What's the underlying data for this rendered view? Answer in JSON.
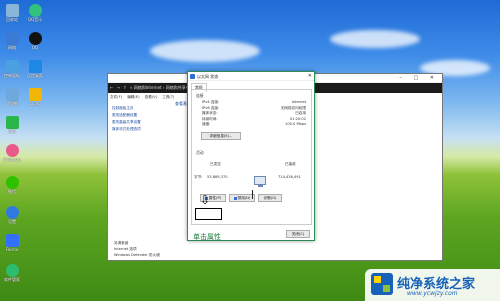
{
  "desktop": {
    "icons_col1": [
      {
        "label": "回收站",
        "color": "#8ab4d8"
      },
      {
        "label": "网络",
        "color": "#3a7bd5"
      },
      {
        "label": "控制面板",
        "color": "#4aa0e0"
      },
      {
        "label": "此电脑",
        "color": "#6fa8dc"
      },
      {
        "label": "360",
        "color": "#2bb54a"
      },
      {
        "label": "Snipaste",
        "color": "#e85a8a"
      },
      {
        "label": "微信",
        "color": "#2dc100"
      },
      {
        "label": "设置",
        "color": "#2f7ae0"
      },
      {
        "label": "Feishu",
        "color": "#3370ff"
      },
      {
        "label": "软件管家",
        "color": "#2dbd6e"
      }
    ],
    "icons_col2": [
      {
        "label": "QQ音乐",
        "color": "#31c27c"
      },
      {
        "label": "QQ",
        "color": "#111111"
      },
      {
        "label": "远程桌面",
        "color": "#1e88e5"
      },
      {
        "label": "1.png",
        "color": "#f2b705"
      }
    ]
  },
  "explorer": {
    "path_text": "« 网络和Internet › 网络和共享中心",
    "menu": [
      "文件(F)",
      "编辑(E)",
      "查看(V)",
      "工具(T)"
    ],
    "sidebar": [
      "控制面板主页",
      "更改适配器设置",
      "更改高级共享设置",
      "媒体流式处理选项"
    ],
    "main_title": "查看基本网络信息并设置连接",
    "bottom": {
      "section": "另请参阅",
      "items": [
        "Internet 选项",
        "Windows Defender 防火墙"
      ]
    }
  },
  "dialog": {
    "title": "以太网 状态",
    "tab": "常规",
    "connection_section": "连接",
    "rows": [
      {
        "k": "IPv4 连接:",
        "v": "Internet"
      },
      {
        "k": "IPv6 连接:",
        "v": "无网络访问权限"
      },
      {
        "k": "媒体状态:",
        "v": "已启用"
      },
      {
        "k": "持续时间:",
        "v": "01:20:02"
      },
      {
        "k": "速度:",
        "v": "100.0 Mbps"
      }
    ],
    "details_button": "详细信息(E)...",
    "activity_section": "活动",
    "sent_label": "已发送",
    "received_label": "已接收",
    "bytes_label": "字节:",
    "bytes_sent": "53,689,370",
    "bytes_received": "714,436,491",
    "properties_button": "属性(P)",
    "disable_button": "禁用(D)",
    "diagnose_button": "诊断(G)",
    "close_button": "关闭(C)",
    "annotation": "单击属性"
  },
  "watermark": {
    "title": "纯净系统之家",
    "url": "www.ycwjzy.com"
  }
}
